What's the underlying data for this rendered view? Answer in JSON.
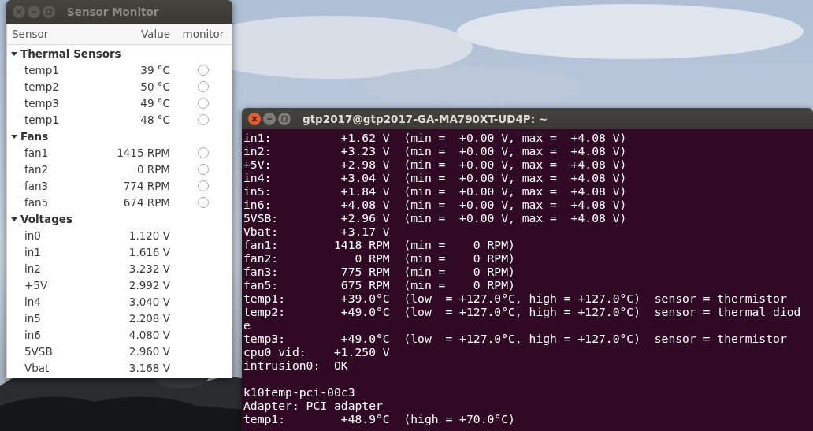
{
  "sensor_window": {
    "title": "Sensor Monitor",
    "active": false,
    "columns": [
      "Sensor",
      "Value",
      "monitor"
    ],
    "groups": [
      {
        "label": "Thermal Sensors",
        "expanded": true,
        "rows": [
          {
            "name": "temp1",
            "value": "39 °C",
            "kind": "radio",
            "checked": false
          },
          {
            "name": "temp2",
            "value": "50 °C",
            "kind": "radio",
            "checked": false
          },
          {
            "name": "temp3",
            "value": "49 °C",
            "kind": "radio",
            "checked": false
          },
          {
            "name": "temp1",
            "value": "48 °C",
            "kind": "radio",
            "checked": false
          }
        ]
      },
      {
        "label": "Fans",
        "expanded": true,
        "rows": [
          {
            "name": "fan1",
            "value": "1415 RPM",
            "kind": "radio",
            "checked": false
          },
          {
            "name": "fan2",
            "value": "0 RPM",
            "kind": "radio",
            "checked": false
          },
          {
            "name": "fan3",
            "value": "774 RPM",
            "kind": "radio",
            "checked": false
          },
          {
            "name": "fan5",
            "value": "674 RPM",
            "kind": "radio",
            "checked": false
          }
        ]
      },
      {
        "label": "Voltages",
        "expanded": true,
        "rows": [
          {
            "name": "in0",
            "value": "1.120 V",
            "kind": "plain"
          },
          {
            "name": "in1",
            "value": "1.616 V",
            "kind": "plain"
          },
          {
            "name": "in2",
            "value": "3.232 V",
            "kind": "plain"
          },
          {
            "name": "+5V",
            "value": "2.992 V",
            "kind": "plain"
          },
          {
            "name": "in4",
            "value": "3.040 V",
            "kind": "plain"
          },
          {
            "name": "in5",
            "value": "2.208 V",
            "kind": "plain"
          },
          {
            "name": "in6",
            "value": "4.080 V",
            "kind": "plain"
          },
          {
            "name": "5VSB",
            "value": "2.960 V",
            "kind": "plain"
          },
          {
            "name": "Vbat",
            "value": "3.168 V",
            "kind": "plain"
          }
        ]
      }
    ]
  },
  "terminal_window": {
    "title": "gtp2017@gtp2017-GA-MA790XT-UD4P: ~",
    "active": true,
    "blocks": [
      {
        "lines": [
          "in1:          +1.62 V  (min =  +0.00 V, max =  +4.08 V)",
          "in2:          +3.23 V  (min =  +0.00 V, max =  +4.08 V)",
          "+5V:          +2.98 V  (min =  +0.00 V, max =  +4.08 V)",
          "in4:          +3.04 V  (min =  +0.00 V, max =  +4.08 V)",
          "in5:          +1.84 V  (min =  +0.00 V, max =  +4.08 V)",
          "in6:          +4.08 V  (min =  +0.00 V, max =  +4.08 V)",
          "5VSB:         +2.96 V  (min =  +0.00 V, max =  +4.08 V)",
          "Vbat:         +3.17 V",
          "fan1:        1418 RPM  (min =    0 RPM)",
          "fan2:           0 RPM  (min =    0 RPM)",
          "fan3:         775 RPM  (min =    0 RPM)",
          "fan5:         675 RPM  (min =    0 RPM)",
          "temp1:        +39.0°C  (low  = +127.0°C, high = +127.0°C)  sensor = thermistor",
          "temp2:        +49.0°C  (low  = +127.0°C, high = +127.0°C)  sensor = thermal diod",
          "e",
          "temp3:        +49.0°C  (low  = +127.0°C, high = +127.0°C)  sensor = thermistor",
          "cpu0_vid:    +1.250 V",
          "intrusion0:  OK"
        ]
      },
      {
        "lines": [
          "k10temp-pci-00c3",
          "Adapter: PCI adapter",
          "temp1:        +48.9°C  (high = +70.0°C)"
        ]
      }
    ]
  }
}
